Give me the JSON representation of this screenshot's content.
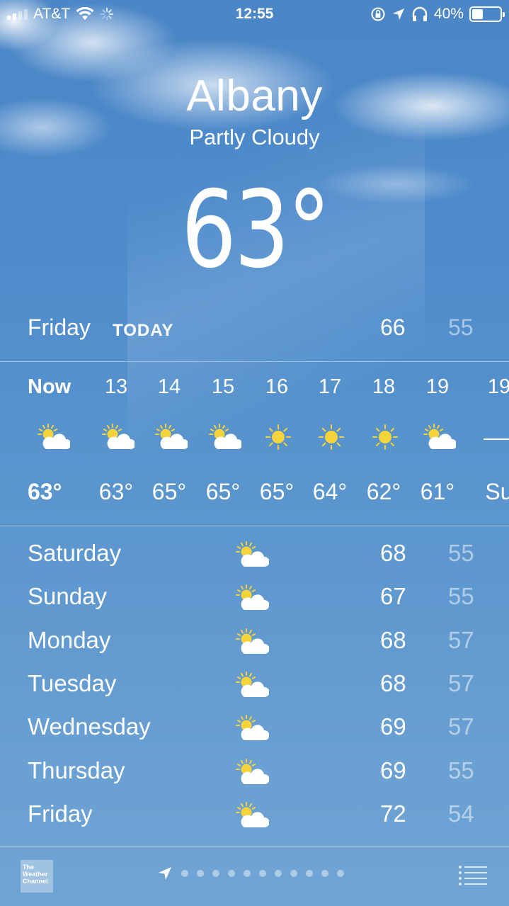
{
  "status_bar": {
    "carrier": "AT&T",
    "time": "12:55",
    "battery": "40%",
    "battery_level": 0.4
  },
  "location": {
    "city": "Albany",
    "condition": "Partly Cloudy",
    "temperature": "63°"
  },
  "today": {
    "day": "Friday",
    "tag": "TODAY",
    "high": "66",
    "low": "55"
  },
  "hourly": [
    {
      "time": "Now",
      "icon": "partly-cloudy",
      "temp": "63°"
    },
    {
      "time": "13",
      "icon": "partly-cloudy",
      "temp": "63°"
    },
    {
      "time": "14",
      "icon": "partly-cloudy",
      "temp": "65°"
    },
    {
      "time": "15",
      "icon": "partly-cloudy",
      "temp": "65°"
    },
    {
      "time": "16",
      "icon": "sunny",
      "temp": "65°"
    },
    {
      "time": "17",
      "icon": "sunny",
      "temp": "64°"
    },
    {
      "time": "18",
      "icon": "sunny",
      "temp": "62°"
    },
    {
      "time": "19",
      "icon": "partly-cloudy",
      "temp": "61°"
    },
    {
      "time": "19",
      "icon": "sunset",
      "temp": "Su"
    }
  ],
  "daily": [
    {
      "day": "Saturday",
      "icon": "partly-cloudy",
      "high": "68",
      "low": "55"
    },
    {
      "day": "Sunday",
      "icon": "partly-cloudy",
      "high": "67",
      "low": "55"
    },
    {
      "day": "Monday",
      "icon": "partly-cloudy",
      "high": "68",
      "low": "57"
    },
    {
      "day": "Tuesday",
      "icon": "partly-cloudy",
      "high": "68",
      "low": "57"
    },
    {
      "day": "Wednesday",
      "icon": "partly-cloudy",
      "high": "69",
      "low": "57"
    },
    {
      "day": "Thursday",
      "icon": "partly-cloudy",
      "high": "69",
      "low": "55"
    },
    {
      "day": "Friday",
      "icon": "partly-cloudy",
      "high": "72",
      "low": "54"
    }
  ],
  "bottom_bar": {
    "logo_text": "The Weather Channel",
    "page_count": 11,
    "list_icon": "list-icon",
    "location_icon": "location-arrow-icon"
  },
  "colors": {
    "sky": "#4d8bcb",
    "sun": "#f5d33a",
    "dim_text": "#a9c6e6"
  }
}
